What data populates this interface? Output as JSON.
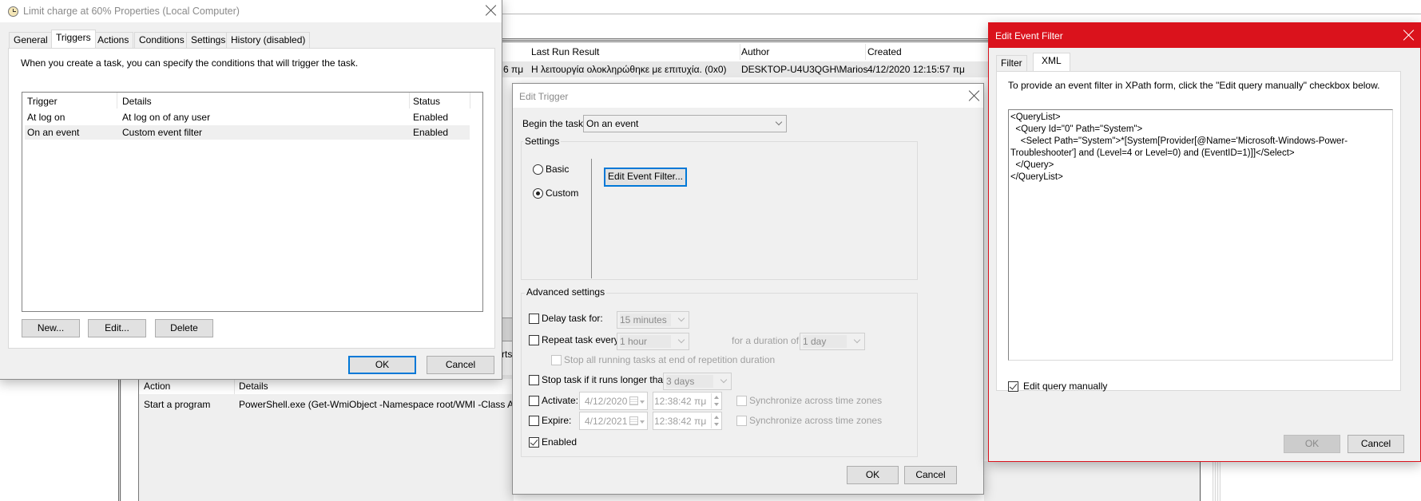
{
  "background": {
    "task_columns": [
      "Last Run Result",
      "Author",
      "Created"
    ],
    "task_row": {
      "last_run_fragment": "6 πμ",
      "last_run_result": "Η λειτουργία ολοκληρώθηκε με επιτυχία. (0x0)",
      "author": "DESKTOP-U4U3QGH\\Marios",
      "created": "4/12/2020 12:15:57 πμ"
    },
    "partial_tab_text": "rts",
    "action_columns": [
      "Action",
      "Details"
    ],
    "action_row": {
      "action": "Start a program",
      "details": "PowerShell.exe (Get-WmiObject -Namespace root/WMI -Class As"
    }
  },
  "properties_dialog": {
    "title": "Limit charge at 60% Properties (Local Computer)",
    "tabs": [
      "General",
      "Triggers",
      "Actions",
      "Conditions",
      "Settings",
      "History (disabled)"
    ],
    "active_tab": "Triggers",
    "description": "When you create a task, you can specify the conditions that will trigger the task.",
    "columns": [
      "Trigger",
      "Details",
      "Status"
    ],
    "rows": [
      {
        "trigger": "At log on",
        "details": "At log on of any user",
        "status": "Enabled"
      },
      {
        "trigger": "On an event",
        "details": "Custom event filter",
        "status": "Enabled"
      }
    ],
    "buttons": {
      "new": "New...",
      "edit": "Edit...",
      "delete": "Delete",
      "ok": "OK",
      "cancel": "Cancel"
    }
  },
  "edit_trigger": {
    "title": "Edit Trigger",
    "begin_label": "Begin the task:",
    "begin_value": "On an event",
    "settings_label": "Settings",
    "radio_basic": "Basic",
    "radio_custom": "Custom",
    "selected_radio": "Custom",
    "edit_filter_button": "Edit Event Filter...",
    "advanced_label": "Advanced settings",
    "delay_label": "Delay task for:",
    "delay_value": "15 minutes",
    "delay_checked": false,
    "repeat_label": "Repeat task every:",
    "repeat_value": "1 hour",
    "repeat_checked": false,
    "duration_label": "for a duration of:",
    "duration_value": "1 day",
    "stop_all_label": "Stop all running tasks at end of repetition duration",
    "stop_longer_label": "Stop task if it runs longer than:",
    "stop_longer_value": "3 days",
    "stop_longer_checked": false,
    "activate_label": "Activate:",
    "activate_date": "4/12/2020",
    "activate_time": "12:38:42 πμ",
    "activate_checked": false,
    "expire_label": "Expire:",
    "expire_date": "4/12/2021",
    "expire_time": "12:38:42 πμ",
    "expire_checked": false,
    "sync_label": "Synchronize across time zones",
    "enabled_label": "Enabled",
    "enabled_checked": true,
    "ok": "OK",
    "cancel": "Cancel"
  },
  "event_filter": {
    "title": "Edit Event Filter",
    "title_bar_color": "#da121c",
    "tabs": [
      "Filter",
      "XML"
    ],
    "active_tab": "XML",
    "instruction": "To provide an event filter in XPath form, click the \"Edit query manually\" checkbox below.",
    "xml": "<QueryList>\n  <Query Id=\"0\" Path=\"System\">\n    <Select Path=\"System\">*[System[Provider[@Name='Microsoft-Windows-Power-Troubleshooter'] and (Level=4 or Level=0) and (EventID=1)]]</Select>\n  </Query>\n</QueryList>",
    "edit_manually_label": "Edit query manually",
    "edit_manually_checked": true,
    "ok": "OK",
    "cancel": "Cancel"
  }
}
